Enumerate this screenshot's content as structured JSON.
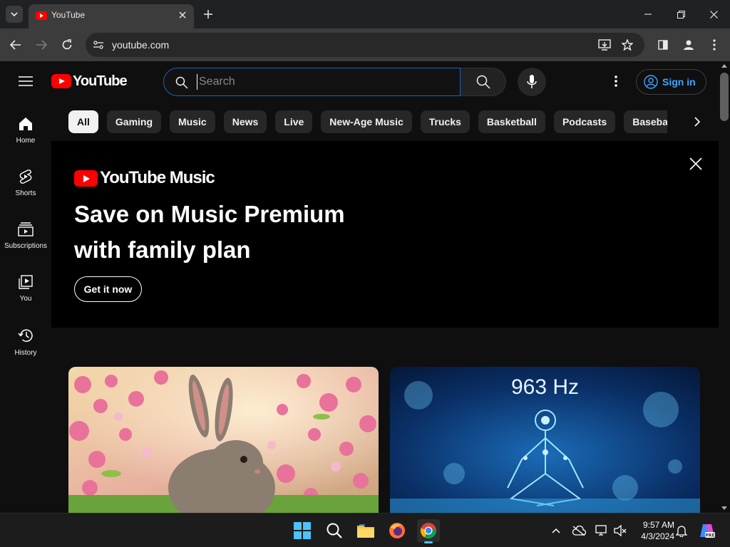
{
  "browser": {
    "tab_title": "YouTube",
    "url": "youtube.com"
  },
  "masthead": {
    "logo_text": "YouTube",
    "search_placeholder": "Search",
    "signin_label": "Sign in"
  },
  "guide": {
    "items": [
      {
        "label": "Home",
        "icon": "home-icon"
      },
      {
        "label": "Shorts",
        "icon": "shorts-icon"
      },
      {
        "label": "Subscriptions",
        "icon": "subscriptions-icon"
      },
      {
        "label": "You",
        "icon": "you-icon"
      },
      {
        "label": "History",
        "icon": "history-icon"
      }
    ]
  },
  "chips": [
    "All",
    "Gaming",
    "Music",
    "News",
    "Live",
    "New-Age Music",
    "Trucks",
    "Basketball",
    "Podcasts",
    "Baseball"
  ],
  "active_chip": "All",
  "banner": {
    "logo_text": "YouTube Music",
    "headline_line1": "Save on Music Premium",
    "headline_line2": "with family plan",
    "cta_label": "Get it now"
  },
  "videos": [
    {
      "thumbnail": "bunny among pink blossoms"
    },
    {
      "thumbnail": "glowing blue meditating figure",
      "overlay_text": "963 Hz"
    }
  ],
  "taskbar": {
    "time": "9:57 AM",
    "date": "4/3/2024"
  },
  "colors": {
    "brand_red": "#ff0000",
    "accent_blue": "#3ea6ff",
    "background": "#0f0f0f"
  }
}
